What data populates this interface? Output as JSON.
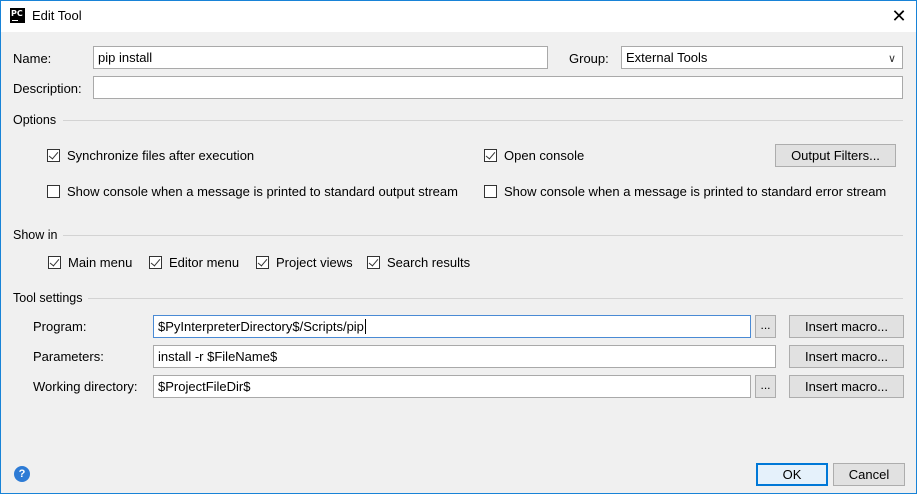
{
  "window": {
    "title": "Edit Tool",
    "app_icon_text": "PC",
    "close_glyph": "✕"
  },
  "form": {
    "name_label": "Name:",
    "name_value": "pip install",
    "group_label": "Group:",
    "group_value": "External Tools",
    "description_label": "Description:",
    "description_value": ""
  },
  "options": {
    "title": "Options",
    "sync_files": {
      "label": "Synchronize files after execution",
      "checked": true
    },
    "open_console": {
      "label": "Open console",
      "checked": true
    },
    "output_filters_label": "Output Filters...",
    "show_console_stdout": {
      "label": "Show console when a message is printed to standard output stream",
      "checked": false
    },
    "show_console_stderr": {
      "label": "Show console when a message is printed to standard error stream",
      "checked": false
    }
  },
  "show_in": {
    "title": "Show in",
    "items": [
      {
        "label": "Main menu",
        "checked": true
      },
      {
        "label": "Editor menu",
        "checked": true
      },
      {
        "label": "Project views",
        "checked": true
      },
      {
        "label": "Search results",
        "checked": true
      }
    ]
  },
  "tool_settings": {
    "title": "Tool settings",
    "program_label": "Program:",
    "program_value": "$PyInterpreterDirectory$/Scripts/pip",
    "parameters_label": "Parameters:",
    "parameters_value": "install -r $FileName$",
    "working_dir_label": "Working directory:",
    "working_dir_value": "$ProjectFileDir$",
    "browse_label": "...",
    "insert_macro_label": "Insert macro..."
  },
  "footer": {
    "help_glyph": "?",
    "ok_label": "OK",
    "cancel_label": "Cancel"
  }
}
